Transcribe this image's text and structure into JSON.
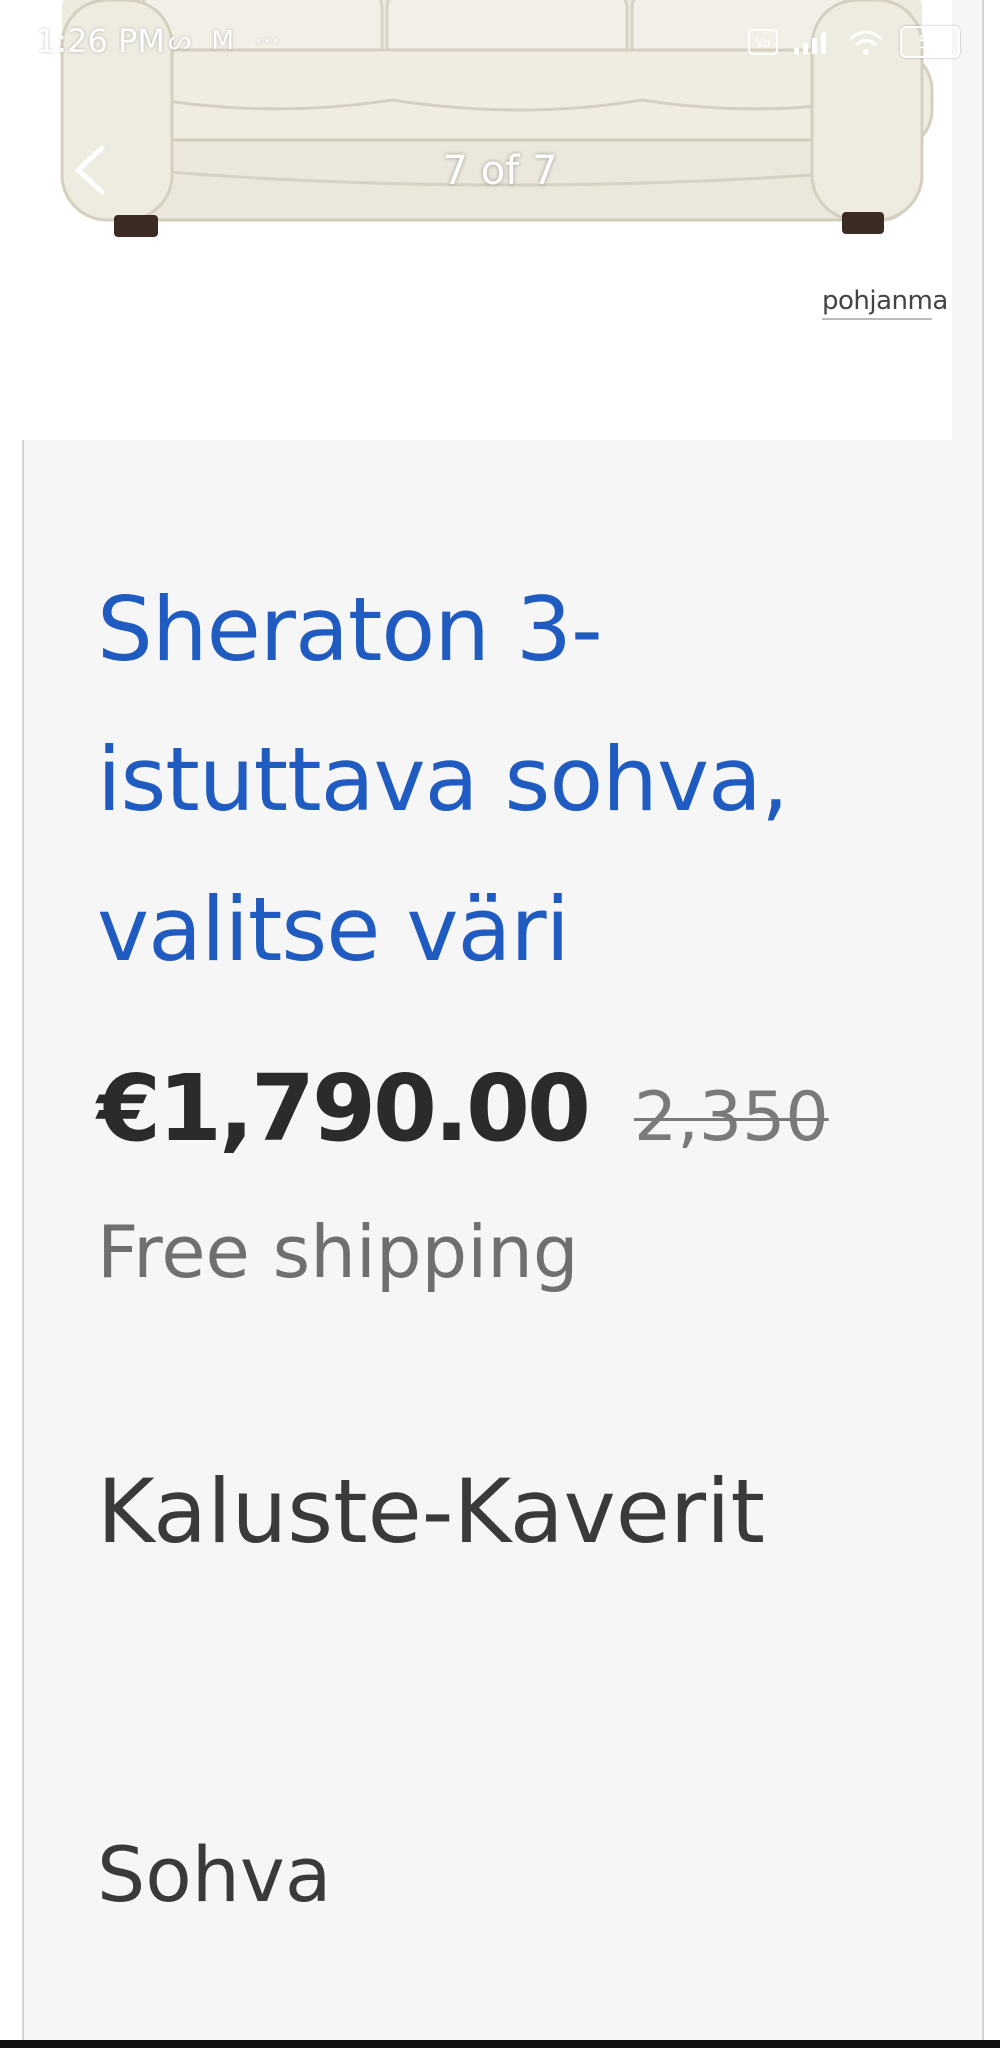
{
  "status_bar": {
    "time": "1:26 PM",
    "left_icons": [
      "s-app-icon",
      "gmail-icon",
      "notification-icon"
    ],
    "battery": "55",
    "right_icons": [
      "volte-icon",
      "signal-icon",
      "wifi-icon",
      "battery-icon"
    ]
  },
  "gallery": {
    "counter": "7 of 7",
    "brand_logo_text": "pohjanma"
  },
  "product": {
    "title": "Sheraton 3-istuttava sohva, valitse väri",
    "price": "€1,790.00",
    "old_price": "2,350",
    "shipping": "Free shipping",
    "seller": "Kaluste-Kaverit",
    "category": "Sohva"
  },
  "colors": {
    "title_blue": "#1f5bc1",
    "background": "#f6f6f6"
  }
}
